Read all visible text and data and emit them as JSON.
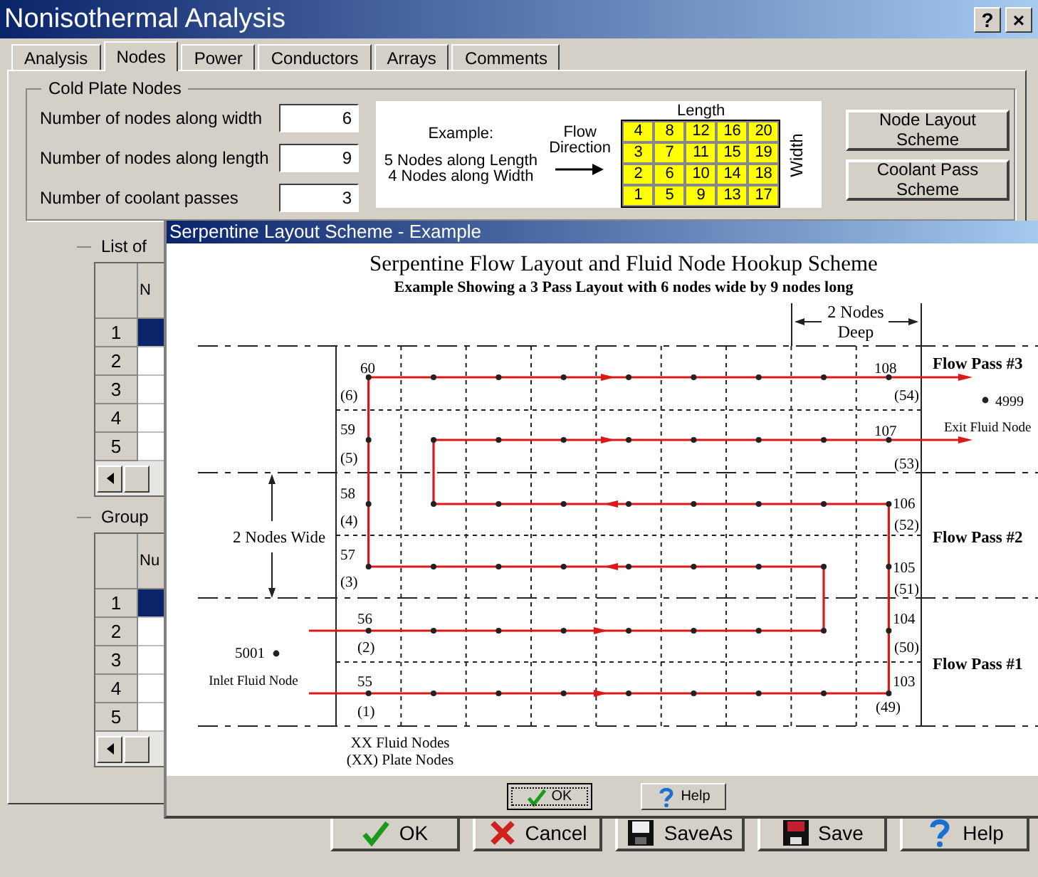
{
  "window": {
    "title": "Nonisothermal Analysis",
    "help_button": "?",
    "close_button": "×"
  },
  "tabs": [
    {
      "label": "Analysis",
      "selected": false
    },
    {
      "label": "Nodes",
      "selected": true
    },
    {
      "label": "Power",
      "selected": false
    },
    {
      "label": "Conductors",
      "selected": false
    },
    {
      "label": "Arrays",
      "selected": false
    },
    {
      "label": "Comments",
      "selected": false
    }
  ],
  "cold_plate_nodes": {
    "title": "Cold Plate Nodes",
    "fields": [
      {
        "label": "Number of nodes along width",
        "value": "6"
      },
      {
        "label": "Number of nodes along length",
        "value": "9"
      },
      {
        "label": "Number of coolant passes",
        "value": "3"
      }
    ],
    "example": {
      "heading": "Example:",
      "lines": [
        "5 Nodes along Length",
        "4 Nodes along Width"
      ],
      "flow_label": "Flow Direction",
      "length_label": "Length",
      "width_label": "Width",
      "grid": [
        [
          "4",
          "8",
          "12",
          "16",
          "20"
        ],
        [
          "3",
          "7",
          "11",
          "15",
          "19"
        ],
        [
          "2",
          "6",
          "10",
          "14",
          "18"
        ],
        [
          "1",
          "5",
          "9",
          "13",
          "17"
        ]
      ]
    },
    "buttons": [
      "Node Layout Scheme",
      "Coolant Pass Scheme"
    ]
  },
  "list_group": {
    "title": "List of",
    "column_1": "N",
    "rows": [
      {
        "number": "1",
        "selected": true
      },
      {
        "number": "2",
        "selected": false
      },
      {
        "number": "3",
        "selected": false
      },
      {
        "number": "4",
        "selected": false
      },
      {
        "number": "5",
        "selected": false
      }
    ]
  },
  "group_group": {
    "title": "Group",
    "column_1": "Nu",
    "rows": [
      {
        "number": "1",
        "selected": true
      },
      {
        "number": "2",
        "selected": false
      },
      {
        "number": "3",
        "selected": false
      },
      {
        "number": "4",
        "selected": false
      },
      {
        "number": "5",
        "selected": false
      }
    ]
  },
  "dialog": {
    "title": "Serpentine Layout Scheme - Example",
    "diagram": {
      "title": "Serpentine Flow Layout and  Fluid Node Hookup Scheme",
      "subtitle": "Example Showing a 3 Pass Layout with 6 nodes wide by 9 nodes long",
      "deep_label_lines": [
        "2 Nodes",
        "Deep"
      ],
      "wide_label": "2 Nodes Wide",
      "passes": [
        {
          "label": "Flow Pass #3"
        },
        {
          "label": "Flow Pass #2"
        },
        {
          "label": "Flow Pass #1"
        }
      ],
      "rows": [
        {
          "left_fluid": "60",
          "left_plate": "(6)",
          "right_fluid": "108",
          "right_plate": "(54)"
        },
        {
          "left_fluid": "59",
          "left_plate": "(5)",
          "right_fluid": "107",
          "right_plate": "(53)"
        },
        {
          "left_fluid": "58",
          "left_plate": "(4)",
          "right_fluid": "106",
          "right_plate": "(52)"
        },
        {
          "left_fluid": "57",
          "left_plate": "(3)",
          "right_fluid": "105",
          "right_plate": "(51)"
        },
        {
          "left_fluid": "56",
          "left_plate": "(2)",
          "right_fluid": "104",
          "right_plate": "(50)"
        },
        {
          "left_fluid": "55",
          "left_plate": "(1)",
          "right_fluid": "103",
          "right_plate": "(49)"
        }
      ],
      "exit": {
        "number": "4999",
        "label": "Exit Fluid Node"
      },
      "inlet": {
        "number": "5001",
        "label": "Inlet Fluid Node"
      },
      "legend": [
        "XX Fluid Nodes",
        "(XX) Plate Nodes"
      ]
    },
    "buttons": [
      {
        "label": "OK",
        "kind": "check",
        "focused": true
      },
      {
        "label": "Help",
        "kind": "help",
        "focused": false
      }
    ]
  },
  "buttons": [
    {
      "label": "OK",
      "kind": "check"
    },
    {
      "label": "Cancel",
      "kind": "cross"
    },
    {
      "label": "SaveAs",
      "kind": "floppy-sa"
    },
    {
      "label": "Save",
      "kind": "floppy"
    },
    {
      "label": "Help",
      "kind": "help"
    }
  ]
}
